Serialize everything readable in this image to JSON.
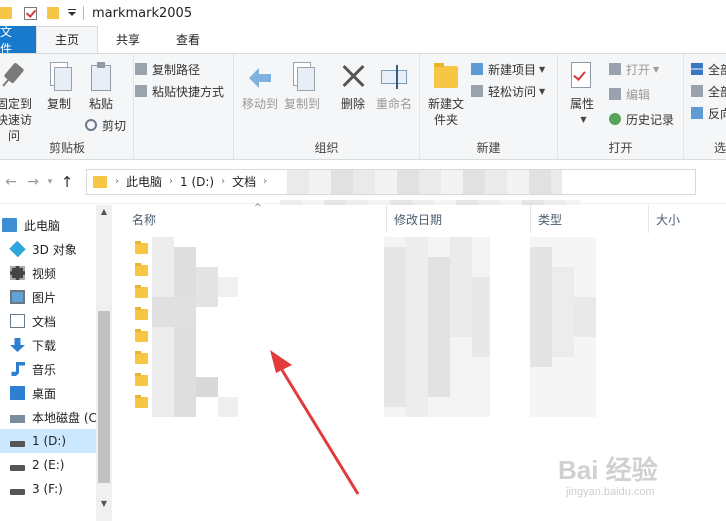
{
  "window": {
    "title": "markmark2005"
  },
  "tabs": [
    {
      "label": "文件"
    },
    {
      "label": "主页"
    },
    {
      "label": "共享"
    },
    {
      "label": "查看"
    }
  ],
  "ribbon": {
    "clipboard": {
      "label": "剪贴板",
      "pin_label": "固定到快速访问",
      "copy_label": "复制",
      "paste_label": "粘贴",
      "copy_path_label": "复制路径",
      "paste_shortcut_label": "粘贴快捷方式",
      "cut_label": "剪切"
    },
    "organize": {
      "label": "组织",
      "move_to_label": "移动到",
      "copy_to_label": "复制到",
      "delete_label": "删除",
      "rename_label": "重命名"
    },
    "new": {
      "label": "新建",
      "new_folder_label": "新建文件夹",
      "new_item_label": "新建项目",
      "easy_access_label": "轻松访问"
    },
    "open": {
      "label": "打开",
      "properties_label": "属性",
      "open_label": "打开",
      "edit_label": "编辑",
      "history_label": "历史记录"
    },
    "select": {
      "label": "选择",
      "select_all_label": "全部选择",
      "select_none_label": "全部取消",
      "invert_label": "反向选择"
    }
  },
  "address": {
    "crumbs": [
      "此电脑",
      "1 (D:)",
      "文档"
    ]
  },
  "nav": {
    "items": [
      {
        "label": "此电脑",
        "icon": "computer-icon"
      },
      {
        "label": "3D 对象",
        "icon": "3d-objects-icon"
      },
      {
        "label": "视频",
        "icon": "video-icon"
      },
      {
        "label": "图片",
        "icon": "pictures-icon"
      },
      {
        "label": "文档",
        "icon": "documents-icon"
      },
      {
        "label": "下载",
        "icon": "downloads-icon"
      },
      {
        "label": "音乐",
        "icon": "music-icon"
      },
      {
        "label": "桌面",
        "icon": "desktop-icon"
      },
      {
        "label": "本地磁盘 (C:)",
        "icon": "local-disk-icon"
      },
      {
        "label": "1 (D:)",
        "icon": "drive-icon",
        "selected": true
      },
      {
        "label": "2 (E:)",
        "icon": "drive-icon"
      },
      {
        "label": "3 (F:)",
        "icon": "drive-icon"
      }
    ]
  },
  "filelist": {
    "columns": [
      "名称",
      "修改日期",
      "类型",
      "大小"
    ],
    "folder_count": 8
  },
  "colors": {
    "file_tab": "#1979ca",
    "selection": "#cce8ff",
    "folder": "#f6c644",
    "annotation_arrow": "#e23b3b"
  },
  "watermark": {
    "brand": "Bai 经验",
    "url": "jingyan.baidu.com"
  }
}
